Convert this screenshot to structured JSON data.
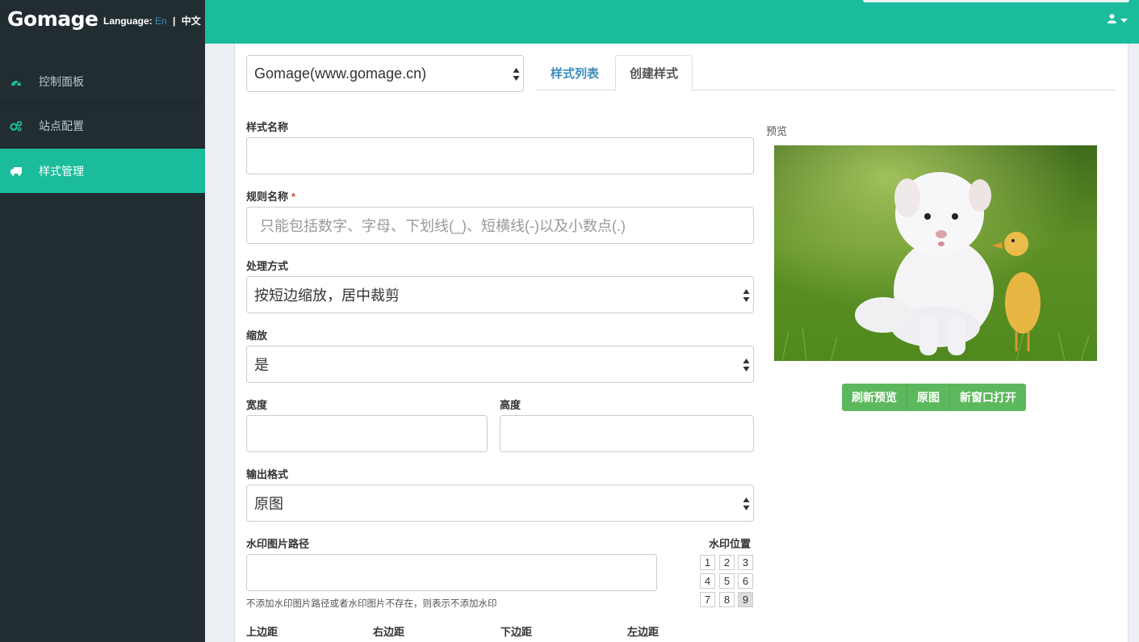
{
  "brand": {
    "logo": "Gomage",
    "language_label": "Language:",
    "lang_en": "En",
    "lang_sep": "|",
    "lang_zh": "中文"
  },
  "sidebar": {
    "items": [
      {
        "label": "控制面板",
        "icon": "dashboard-icon",
        "active": false
      },
      {
        "label": "站点配置",
        "icon": "cogs-icon",
        "active": false
      },
      {
        "label": "样式管理",
        "icon": "truck-icon",
        "active": true
      }
    ]
  },
  "header": {
    "user_icon": "user-icon",
    "caret_icon": "caret-down-icon"
  },
  "site_select": {
    "value": "Gomage(www.gomage.cn)"
  },
  "tabs": [
    {
      "label": "样式列表",
      "active": false
    },
    {
      "label": "创建样式",
      "active": true
    }
  ],
  "form": {
    "style_name": {
      "label": "样式名称",
      "value": ""
    },
    "rule_name": {
      "label": "规则名称",
      "required": "*",
      "placeholder": "只能包括数字、字母、下划线(_)、短横线(-)以及小数点(.)"
    },
    "process_mode": {
      "label": "处理方式",
      "value": "按短边缩放，居中裁剪"
    },
    "scale": {
      "label": "缩放",
      "value": "是"
    },
    "width": {
      "label": "宽度",
      "value": ""
    },
    "height": {
      "label": "高度",
      "value": ""
    },
    "output_format": {
      "label": "输出格式",
      "value": "原图"
    },
    "watermark_path": {
      "label": "水印图片路径",
      "value": "",
      "help": "不添加水印图片路径或者水印图片不存在，则表示不添加水印"
    },
    "watermark_position": {
      "label": "水印位置",
      "cells": [
        "1",
        "2",
        "3",
        "4",
        "5",
        "6",
        "7",
        "8",
        "9"
      ],
      "selected": "9"
    },
    "margins": {
      "top": "上边距",
      "right": "右边距",
      "bottom": "下边距",
      "left": "左边距"
    }
  },
  "preview": {
    "label": "预览",
    "buttons": {
      "refresh": "刷新预览",
      "original": "原图",
      "new_window": "新窗口打开"
    }
  },
  "colors": {
    "accent": "#1abc9c",
    "sidebar": "#222d32",
    "link": "#3c8dbc",
    "success": "#5cb85c"
  }
}
